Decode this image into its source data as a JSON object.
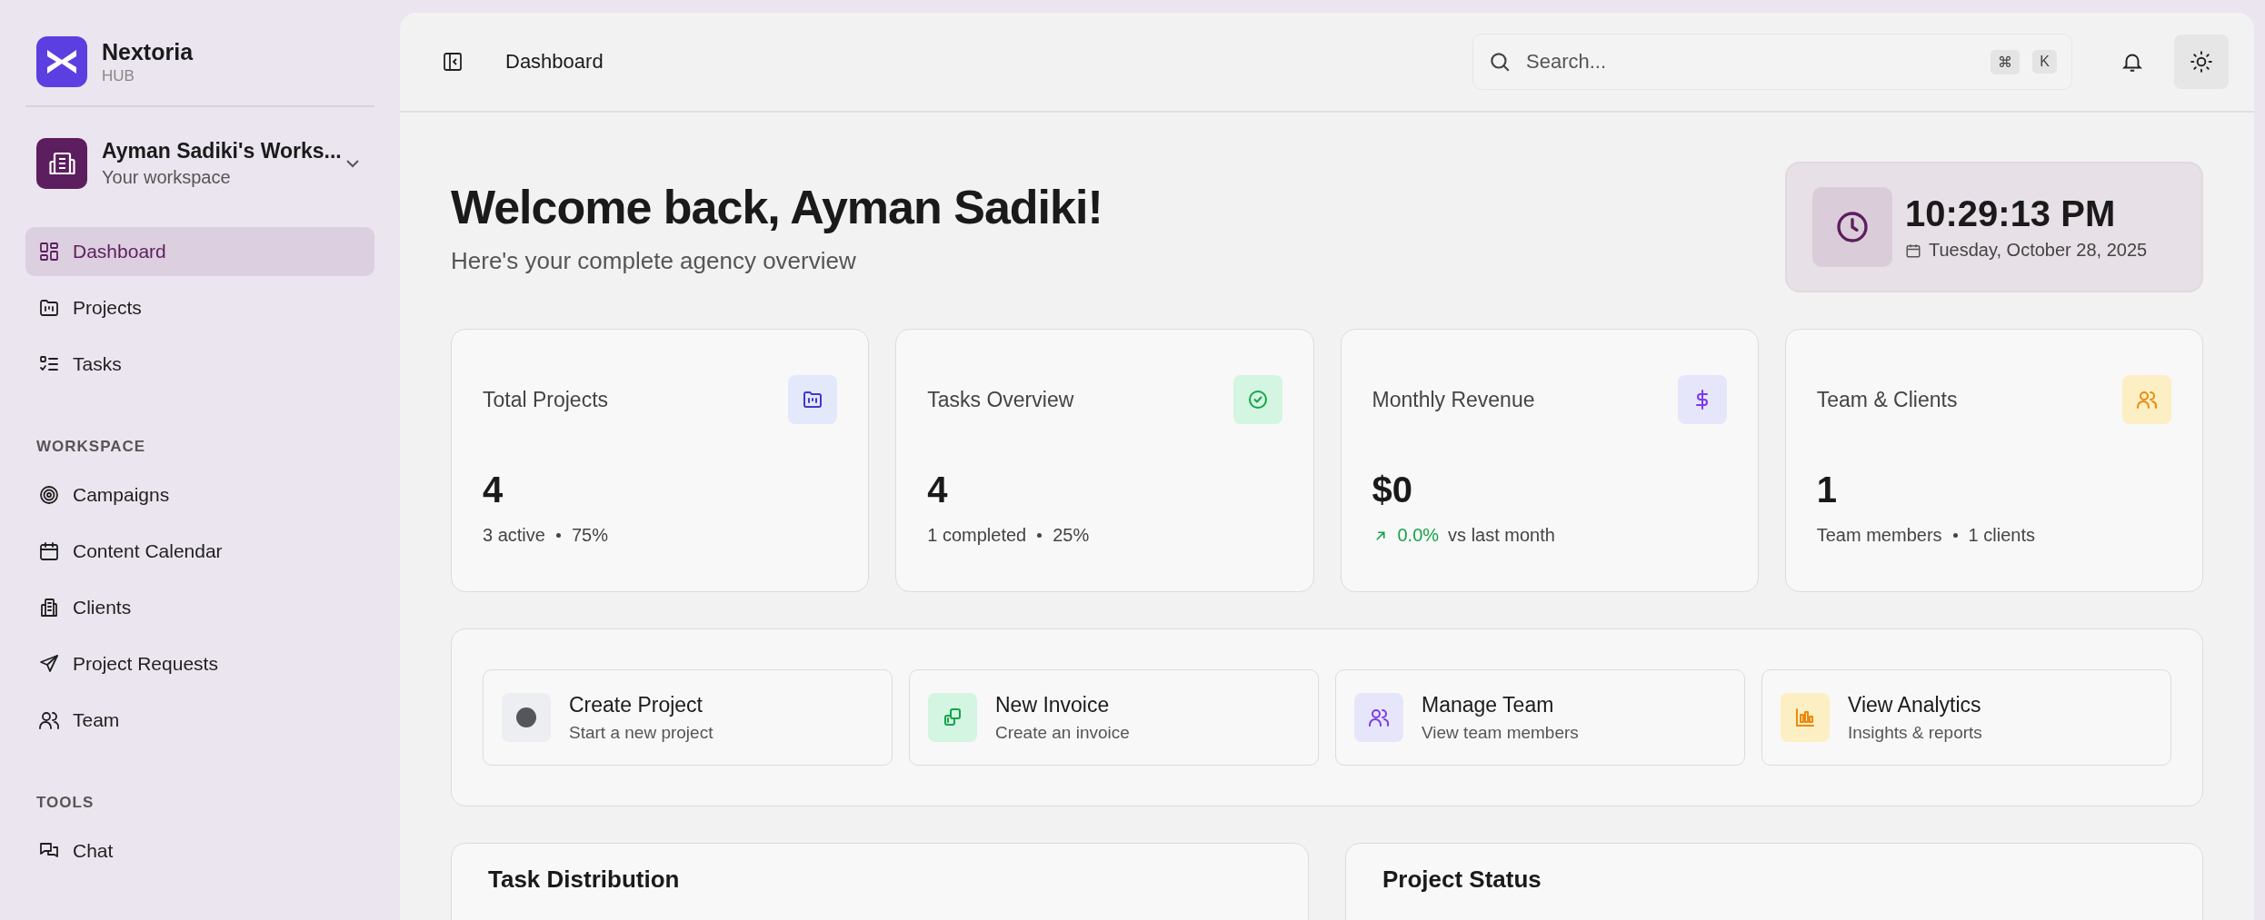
{
  "brand": {
    "name": "Nextoria",
    "sub": "HUB"
  },
  "workspace": {
    "name": "Ayman Sadiki's Works...",
    "sub": "Your workspace"
  },
  "nav": [
    {
      "label": "Dashboard",
      "selected": true
    },
    {
      "label": "Projects",
      "selected": false
    },
    {
      "label": "Tasks",
      "selected": false
    }
  ],
  "workspace_section": {
    "heading": "WORKSPACE",
    "items": [
      {
        "label": "Campaigns",
        "selected": false
      },
      {
        "label": "Content Calendar",
        "selected": false
      },
      {
        "label": "Clients",
        "selected": false
      },
      {
        "label": "Project Requests",
        "selected": false
      },
      {
        "label": "Team",
        "selected": false
      }
    ]
  },
  "tools_section": {
    "heading": "TOOLS",
    "items": [
      {
        "label": "Chat",
        "selected": false
      }
    ]
  },
  "header": {
    "breadcrumb": "Dashboard",
    "search": {
      "placeholder": "Search..."
    },
    "shortcut_keys": [
      "⌘",
      "K"
    ]
  },
  "welcome": {
    "title": "Welcome back, Ayman Sadiki!",
    "subtitle": "Here's your complete agency overview"
  },
  "clock": {
    "time": "10:29:13 PM",
    "date": "Tuesday, October 28, 2025"
  },
  "stats": [
    {
      "kind": "split",
      "title": "Total Projects",
      "value": "4",
      "details": [
        "3 active",
        "75%"
      ]
    },
    {
      "kind": "split",
      "title": "Tasks Overview",
      "value": "4",
      "details": [
        "1 completed",
        "25%"
      ]
    },
    {
      "kind": "trend",
      "title": "Monthly Revenue",
      "value": "$0",
      "change": "0.0%",
      "note": "vs last month"
    },
    {
      "kind": "split",
      "title": "Team & Clients",
      "value": "1",
      "details": [
        "Team members",
        "1 clients"
      ]
    }
  ],
  "quick_actions": [
    {
      "title": "Create Project",
      "subtitle": "Start a new project"
    },
    {
      "title": "New Invoice",
      "subtitle": "Create an invoice"
    },
    {
      "title": "Manage Team",
      "subtitle": "View team members"
    },
    {
      "title": "View Analytics",
      "subtitle": "Insights & reports"
    }
  ],
  "panels": [
    {
      "title": "Task Distribution"
    },
    {
      "title": "Project Status"
    }
  ]
}
